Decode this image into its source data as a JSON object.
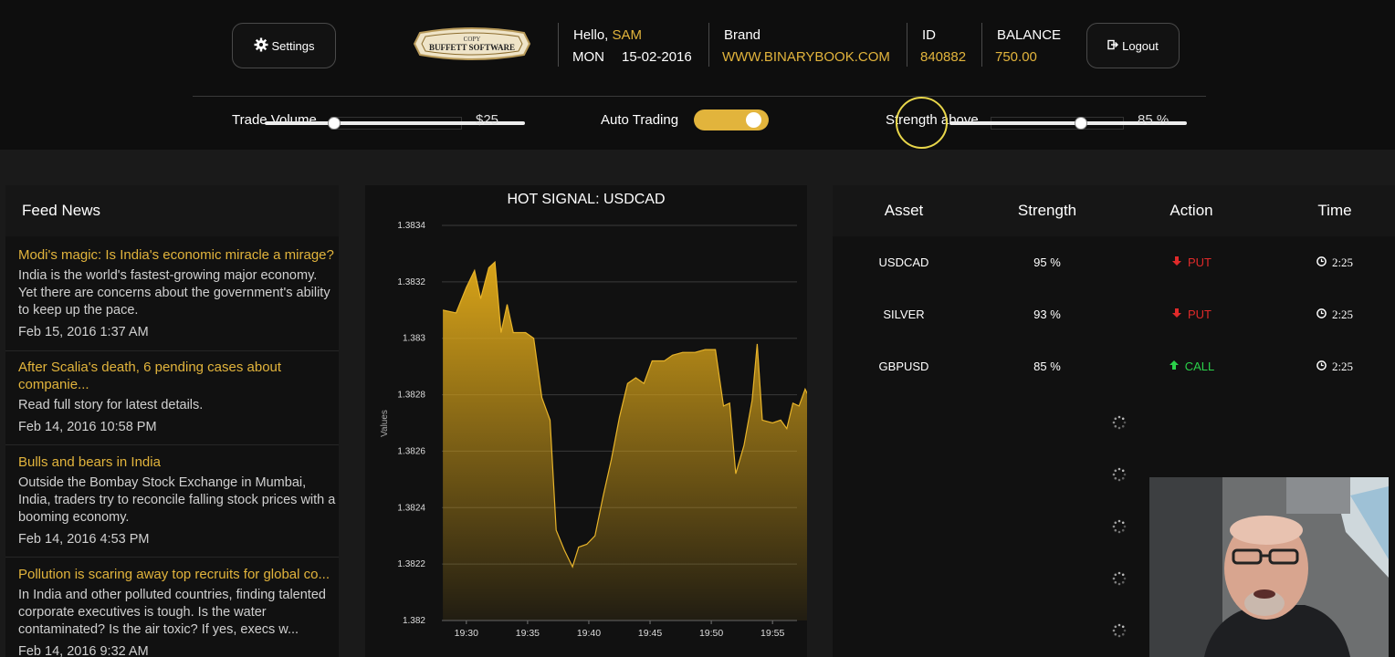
{
  "header": {
    "settings_label": "Settings",
    "logout_label": "Logout",
    "logo_line1": "COPY",
    "logo_line2": "BUFFETT SOFTWARE",
    "greeting": "Hello,",
    "user_name": "SAM",
    "day": "MON",
    "date": "15-02-2016",
    "brand_label": "Brand",
    "brand_value": "WWW.BINARYBOOK.COM",
    "id_label": "ID",
    "id_value": "840882",
    "balance_label": "BALANCE",
    "balance_value": "750.00"
  },
  "controls": {
    "trade_volume_label": "Trade Volume",
    "trade_volume_value": "$25",
    "trade_volume_level": 0.27,
    "auto_trading_label": "Auto Trading",
    "auto_trading_on": true,
    "strength_label": "Strength above",
    "strength_value": "85 %",
    "strength_level": 0.85
  },
  "feed": {
    "title": "Feed News",
    "items": [
      {
        "title": "Modi's magic: Is India's economic miracle a mirage?",
        "body": "India is the world's fastest-growing major economy. Yet there are concerns about the government's ability to keep up the pace.",
        "date": "Feb 15, 2016 1:37 AM"
      },
      {
        "title": "After Scalia's death, 6 pending cases about companie...",
        "body": "Read full story for latest details.",
        "date": "Feb 14, 2016 10:58 PM"
      },
      {
        "title": "Bulls and bears in India",
        "body": "Outside the Bombay Stock Exchange in Mumbai, India, traders try to reconcile falling stock prices with a booming economy.",
        "date": "Feb 14, 2016 4:53 PM"
      },
      {
        "title": "Pollution is scaring away top recruits for global co...",
        "body": "In India and other polluted countries, finding talented corporate executives is tough. Is the water contaminated? Is the air toxic? If yes, execs w...",
        "date": "Feb 14, 2016 9:32 AM"
      }
    ]
  },
  "chart_data": {
    "type": "area",
    "title": "HOT SIGNAL: USDCAD",
    "xlabel": "",
    "ylabel": "Values",
    "ylim": [
      1.382,
      1.3834
    ],
    "yticks": [
      "1.3834",
      "1.3832",
      "1.383",
      "1.3828",
      "1.3826",
      "1.3824",
      "1.3822",
      "1.382"
    ],
    "xlim": [
      "19:28",
      "19:57"
    ],
    "xticks": [
      "19:30",
      "19:35",
      "19:40",
      "19:45",
      "19:50",
      "19:55"
    ],
    "grid": true,
    "color": "#d9a419",
    "series": [
      {
        "values": [
          [
            "19:28:05",
            1.3831
          ],
          [
            "19:29:10",
            1.38309
          ],
          [
            "19:30:00",
            1.38318
          ],
          [
            "19:30:40",
            1.38324
          ],
          [
            "19:31:10",
            1.38314
          ],
          [
            "19:31:50",
            1.38325
          ],
          [
            "19:32:20",
            1.38327
          ],
          [
            "19:32:50",
            1.38302
          ],
          [
            "19:33:20",
            1.38312
          ],
          [
            "19:33:50",
            1.38302
          ],
          [
            "19:34:50",
            1.38302
          ],
          [
            "19:35:30",
            1.383
          ],
          [
            "19:36:10",
            1.38279
          ],
          [
            "19:36:50",
            1.38271
          ],
          [
            "19:37:20",
            1.38232
          ],
          [
            "19:38:00",
            1.38225
          ],
          [
            "19:38:40",
            1.38219
          ],
          [
            "19:39:10",
            1.38226
          ],
          [
            "19:39:50",
            1.38227
          ],
          [
            "19:40:30",
            1.3823
          ],
          [
            "19:41:10",
            1.38244
          ],
          [
            "19:41:50",
            1.38257
          ],
          [
            "19:42:30",
            1.38272
          ],
          [
            "19:43:10",
            1.38284
          ],
          [
            "19:43:50",
            1.38286
          ],
          [
            "19:44:30",
            1.38284
          ],
          [
            "19:45:10",
            1.38292
          ],
          [
            "19:46:10",
            1.38292
          ],
          [
            "19:46:50",
            1.38294
          ],
          [
            "19:47:40",
            1.38295
          ],
          [
            "19:48:40",
            1.38295
          ],
          [
            "19:49:30",
            1.38296
          ],
          [
            "19:50:20",
            1.38296
          ],
          [
            "19:51:00",
            1.38276
          ],
          [
            "19:51:30",
            1.38277
          ],
          [
            "19:52:00",
            1.38252
          ],
          [
            "19:52:40",
            1.38262
          ],
          [
            "19:53:20",
            1.38278
          ],
          [
            "19:53:45",
            1.38298
          ],
          [
            "19:54:10",
            1.38271
          ],
          [
            "19:55:00",
            1.3827
          ],
          [
            "19:55:40",
            1.38271
          ],
          [
            "19:56:10",
            1.38268
          ],
          [
            "19:56:40",
            1.38277
          ],
          [
            "19:57:10",
            1.38276
          ],
          [
            "19:57:40",
            1.38282
          ],
          [
            "19:58:00",
            1.38279
          ]
        ]
      }
    ]
  },
  "signals": {
    "headers": [
      "Asset",
      "Strength",
      "Action",
      "Time"
    ],
    "rows": [
      {
        "asset": "USDCAD",
        "strength": "95 %",
        "action": "PUT",
        "direction": "down",
        "time": "2:25"
      },
      {
        "asset": "SILVER",
        "strength": "93 %",
        "action": "PUT",
        "direction": "down",
        "time": "2:25"
      },
      {
        "asset": "GBPUSD",
        "strength": "85 %",
        "action": "CALL",
        "direction": "up",
        "time": "2:25"
      }
    ],
    "colors": {
      "put": "#e02a2a",
      "call": "#2bd14a",
      "accent": "#e2b43c"
    }
  },
  "icons": {
    "settings": "gear-icon",
    "logout": "logout-icon",
    "put": "arrow-down-icon",
    "call": "arrow-up-icon",
    "time": "clock-icon",
    "loading": "spinner-icon"
  }
}
